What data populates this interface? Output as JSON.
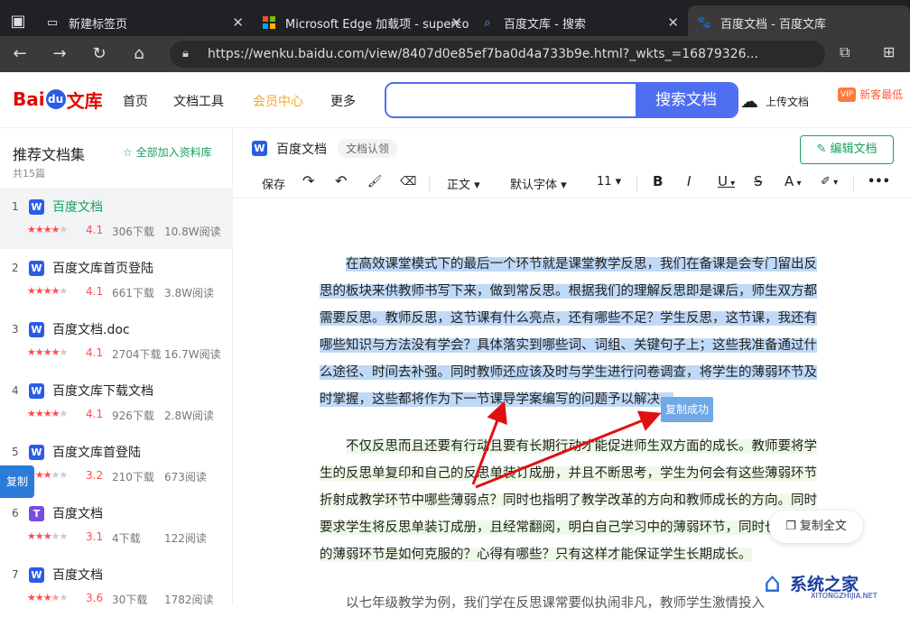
{
  "browser": {
    "tabs": [
      {
        "title": "新建标签页",
        "active": false
      },
      {
        "title": "Microsoft Edge 加载项 - superco",
        "active": false
      },
      {
        "title": "百度文库 - 搜索",
        "active": false
      },
      {
        "title": "百度文档 - 百度文库",
        "active": true
      }
    ],
    "url": "https://wenku.baidu.com/view/8407d0e85ef7ba0d4a733b9e.html?_wkts_=16879326..."
  },
  "site": {
    "logo_text": "Bai du 文库",
    "nav": [
      "首页",
      "文档工具",
      "会员中心",
      "更多"
    ],
    "search_button": "搜索文档",
    "search_placeholder": "",
    "upload_label": "上传文档",
    "vip_label": "新客最低",
    "brand_blue": "#4e6ef2",
    "accent_gold": "#f5a623"
  },
  "sidebar": {
    "title": "推荐文档集",
    "count": "共15篇",
    "add_all": "全部加入资料库",
    "copy_tab": "复制",
    "docs": [
      {
        "num": "1",
        "icon": "W",
        "name": "百度文档",
        "stars": 4,
        "score": "4.1",
        "downloads": "306下载",
        "reads": "10.8W阅读",
        "selected": true
      },
      {
        "num": "2",
        "icon": "W",
        "name": "百度文库首页登陆",
        "stars": 4,
        "score": "4.1",
        "downloads": "661下载",
        "reads": "3.8W阅读",
        "selected": false
      },
      {
        "num": "3",
        "icon": "W",
        "name": "百度文档.doc",
        "stars": 4,
        "score": "4.1",
        "downloads": "2704下载",
        "reads": "16.7W阅读",
        "selected": false
      },
      {
        "num": "4",
        "icon": "W",
        "name": "百度文库下载文档",
        "stars": 4,
        "score": "4.1",
        "downloads": "926下载",
        "reads": "2.8W阅读",
        "selected": false
      },
      {
        "num": "5",
        "icon": "W",
        "name": "百度文库首登陆",
        "stars": 3,
        "score": "3.2",
        "downloads": "210下载",
        "reads": "673阅读",
        "selected": false
      },
      {
        "num": "6",
        "icon": "T",
        "name": "百度文档",
        "stars": 3,
        "score": "3.1",
        "downloads": "4下载",
        "reads": "122阅读",
        "selected": false
      },
      {
        "num": "7",
        "icon": "W",
        "name": "百度文档",
        "stars": 3.5,
        "score": "3.6",
        "downloads": "30下载",
        "reads": "1782阅读",
        "selected": false
      }
    ]
  },
  "document": {
    "title": "百度文档",
    "claim": "文档认领",
    "edit_button": "编辑文档",
    "toolbar": {
      "save": "保存",
      "style": "正文",
      "font": "默认字体",
      "size": "11",
      "bold": "B",
      "italic": "I",
      "underline": "U",
      "strike": "S",
      "fontcolor": "A",
      "more": "•••"
    },
    "para1": "在高效课堂模式下的最后一个环节就是课堂教学反思，我们在备课是会专门留出反思的板块来供教师书写下来，做到常反思。根据我们的理解反思即是课后，师生双方都需要反思。教师反思，这节课有什么亮点，还有哪些不足？学生反思，这节课，我还有哪些知识与方法没有学会？具体落实到哪些词、词组、关键句子上；这些我准备通过什么途径、时间去补强。同时教师还应该及时与学生进行问卷调查，将学生的薄弱环节及时掌握，这些都将作为下一节课导学案编写的问题予以解决。",
    "para2": "不仅反思而且还要有行动且要有长期行动才能促进师生双方面的成长。教师要将学生的反思单复印和自己的反思单装订成册，并且不断思考，学生为何会有这些薄弱环节折射成教学环节中哪些薄弱点？同时也指明了教学改革的方向和教师成长的方向。同时要求学生将反思单装订成册，且经常翻阅，明白自己学习中的薄弱环节，同时也让学生",
    "para2b": "的薄弱环节是如何克服的？心得有哪些？只有这样才能保证学生长期成长。",
    "para3": "以七年级教学为例，我们学在反思课常要似执闹非凡，教师学生激情投入",
    "copy_success": "复制成功",
    "copy_all": "复制全文"
  },
  "watermark": {
    "text": "系统之家",
    "sub": "XITONGZHIJIA.NET"
  }
}
